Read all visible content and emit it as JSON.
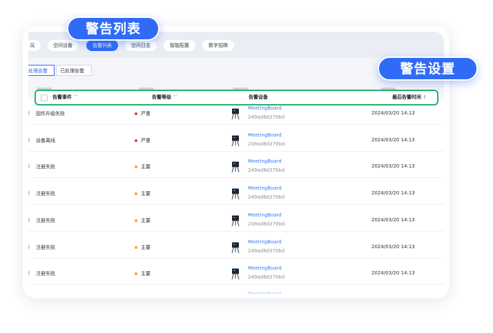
{
  "callouts": {
    "alert_list": "警告列表",
    "alert_settings": "警告设置"
  },
  "nav": {
    "items": [
      {
        "label": "况",
        "active": false
      },
      {
        "label": "空间设备",
        "active": false
      },
      {
        "label": "告警列表",
        "active": true
      },
      {
        "label": "空间日志",
        "active": false
      },
      {
        "label": "智能配置",
        "active": false
      },
      {
        "label": "数字招牌",
        "active": false
      }
    ]
  },
  "subtabs": [
    {
      "label": "处理告警",
      "active": true
    },
    {
      "label": "已处理告警",
      "active": false
    }
  ],
  "table": {
    "columns": [
      {
        "label": "告警事件",
        "arrow": "﹀"
      },
      {
        "label": "告警等级",
        "arrow": "﹀"
      },
      {
        "label": "告警设备",
        "arrow": ""
      },
      {
        "label": "最后告警时间",
        "arrow": "⇕"
      }
    ],
    "rows": [
      {
        "event": "固件升级失败",
        "level": "严重",
        "device_name": "MeetingBoard",
        "device_id": "249ad8d379bd",
        "time": "2024/03/20 14:13"
      },
      {
        "event": "设备离线",
        "level": "严重",
        "device_name": "MeetingBoard",
        "device_id": "249ad8d379bd",
        "time": "2024/03/20 14:13"
      },
      {
        "event": "注册失败",
        "level": "主要",
        "device_name": "MeetingBoard",
        "device_id": "249ad8d379bd",
        "time": "2024/03/20 14:13"
      },
      {
        "event": "注册失败",
        "level": "主要",
        "device_name": "MeetingBoard",
        "device_id": "249ad8d379bd",
        "time": "2024/03/20 14:13"
      },
      {
        "event": "注册失败",
        "level": "主要",
        "device_name": "MeetingBoard",
        "device_id": "249ad8d379bd",
        "time": "2024/03/20 14:13"
      },
      {
        "event": "注册失败",
        "level": "主要",
        "device_name": "MeetingBoard",
        "device_id": "249ad8d379bd",
        "time": "2024/03/20 14:13"
      },
      {
        "event": "注册失败",
        "level": "主要",
        "device_name": "MeetingBoard",
        "device_id": "249ad8d379bd",
        "time": "2024/03/20 14:13"
      }
    ],
    "truncated_row": {
      "device_name": "MeetingBoard"
    }
  },
  "colors": {
    "accent": "#2f6bf6",
    "highlight_border": "#20b26b",
    "level_severe": "#e53935",
    "level_major": "#f5a623",
    "device_link": "#3a78f5"
  },
  "icons": {
    "device": "meeting-board-icon",
    "checkbox": "checkbox-icon",
    "sort": "sort-icon",
    "filter": "chevron-down-icon"
  }
}
